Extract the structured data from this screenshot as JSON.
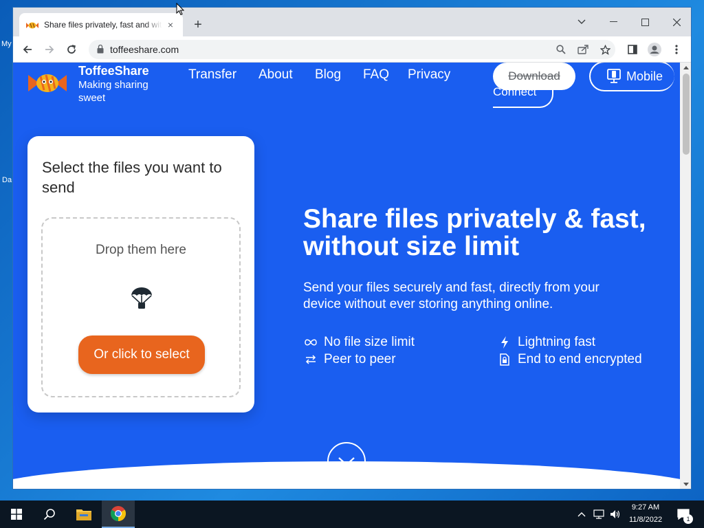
{
  "desktop": {
    "labels": [
      "My",
      "Da"
    ]
  },
  "browser": {
    "tab_title": "Share files privately, fast and without size limit",
    "url": "toffeeshare.com",
    "new_tab_glyph": "+",
    "close_tab_glyph": "×"
  },
  "site": {
    "brand_name": "ToffeeShare",
    "brand_tagline": "Making sharing sweet",
    "nav": [
      "Transfer",
      "About",
      "Blog",
      "FAQ",
      "Privacy"
    ],
    "download_label": "Download",
    "connect_label": "Connect",
    "mobile_label": "Mobile"
  },
  "upload_card": {
    "title": "Select the files you want to send",
    "drop_text": "Drop them here",
    "select_button": "Or click to select"
  },
  "hero": {
    "title": "Share files privately & fast, without size limit",
    "subtitle": "Send your files securely and fast, directly from your device without ever storing anything online.",
    "features": [
      {
        "icon": "infinity-icon",
        "label": "No file size limit"
      },
      {
        "icon": "lightning-icon",
        "label": "Lightning fast"
      },
      {
        "icon": "swap-arrows-icon",
        "label": "Peer to peer"
      },
      {
        "icon": "lock-file-icon",
        "label": "End to end encrypted"
      }
    ]
  },
  "taskbar": {
    "time": "9:27 AM",
    "date": "11/8/2022",
    "notification_count": "1"
  },
  "colors": {
    "page_blue": "#1a5ef0",
    "select_orange": "#e8651e",
    "taskbar": "#0b1622"
  }
}
